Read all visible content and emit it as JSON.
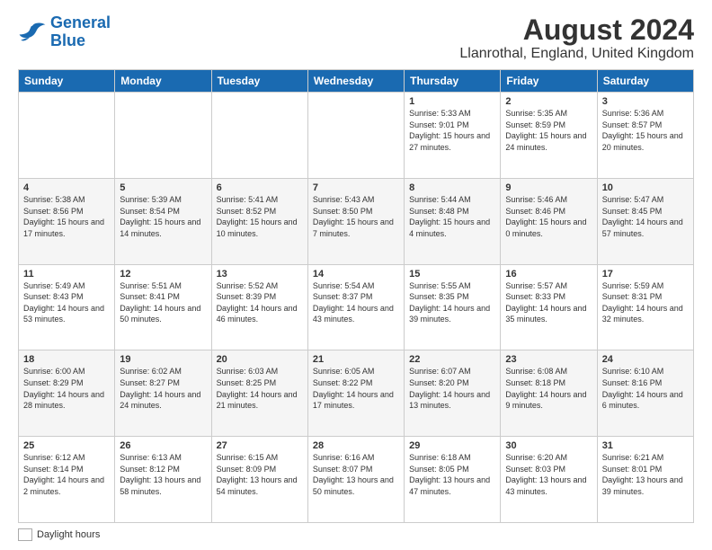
{
  "header": {
    "logo_general": "General",
    "logo_blue": "Blue",
    "month_year": "August 2024",
    "location": "Llanrothal, England, United Kingdom"
  },
  "weekdays": [
    "Sunday",
    "Monday",
    "Tuesday",
    "Wednesday",
    "Thursday",
    "Friday",
    "Saturday"
  ],
  "weeks": [
    [
      {
        "day": "",
        "info": ""
      },
      {
        "day": "",
        "info": ""
      },
      {
        "day": "",
        "info": ""
      },
      {
        "day": "",
        "info": ""
      },
      {
        "day": "1",
        "info": "Sunrise: 5:33 AM\nSunset: 9:01 PM\nDaylight: 15 hours and 27 minutes."
      },
      {
        "day": "2",
        "info": "Sunrise: 5:35 AM\nSunset: 8:59 PM\nDaylight: 15 hours and 24 minutes."
      },
      {
        "day": "3",
        "info": "Sunrise: 5:36 AM\nSunset: 8:57 PM\nDaylight: 15 hours and 20 minutes."
      }
    ],
    [
      {
        "day": "4",
        "info": "Sunrise: 5:38 AM\nSunset: 8:56 PM\nDaylight: 15 hours and 17 minutes."
      },
      {
        "day": "5",
        "info": "Sunrise: 5:39 AM\nSunset: 8:54 PM\nDaylight: 15 hours and 14 minutes."
      },
      {
        "day": "6",
        "info": "Sunrise: 5:41 AM\nSunset: 8:52 PM\nDaylight: 15 hours and 10 minutes."
      },
      {
        "day": "7",
        "info": "Sunrise: 5:43 AM\nSunset: 8:50 PM\nDaylight: 15 hours and 7 minutes."
      },
      {
        "day": "8",
        "info": "Sunrise: 5:44 AM\nSunset: 8:48 PM\nDaylight: 15 hours and 4 minutes."
      },
      {
        "day": "9",
        "info": "Sunrise: 5:46 AM\nSunset: 8:46 PM\nDaylight: 15 hours and 0 minutes."
      },
      {
        "day": "10",
        "info": "Sunrise: 5:47 AM\nSunset: 8:45 PM\nDaylight: 14 hours and 57 minutes."
      }
    ],
    [
      {
        "day": "11",
        "info": "Sunrise: 5:49 AM\nSunset: 8:43 PM\nDaylight: 14 hours and 53 minutes."
      },
      {
        "day": "12",
        "info": "Sunrise: 5:51 AM\nSunset: 8:41 PM\nDaylight: 14 hours and 50 minutes."
      },
      {
        "day": "13",
        "info": "Sunrise: 5:52 AM\nSunset: 8:39 PM\nDaylight: 14 hours and 46 minutes."
      },
      {
        "day": "14",
        "info": "Sunrise: 5:54 AM\nSunset: 8:37 PM\nDaylight: 14 hours and 43 minutes."
      },
      {
        "day": "15",
        "info": "Sunrise: 5:55 AM\nSunset: 8:35 PM\nDaylight: 14 hours and 39 minutes."
      },
      {
        "day": "16",
        "info": "Sunrise: 5:57 AM\nSunset: 8:33 PM\nDaylight: 14 hours and 35 minutes."
      },
      {
        "day": "17",
        "info": "Sunrise: 5:59 AM\nSunset: 8:31 PM\nDaylight: 14 hours and 32 minutes."
      }
    ],
    [
      {
        "day": "18",
        "info": "Sunrise: 6:00 AM\nSunset: 8:29 PM\nDaylight: 14 hours and 28 minutes."
      },
      {
        "day": "19",
        "info": "Sunrise: 6:02 AM\nSunset: 8:27 PM\nDaylight: 14 hours and 24 minutes."
      },
      {
        "day": "20",
        "info": "Sunrise: 6:03 AM\nSunset: 8:25 PM\nDaylight: 14 hours and 21 minutes."
      },
      {
        "day": "21",
        "info": "Sunrise: 6:05 AM\nSunset: 8:22 PM\nDaylight: 14 hours and 17 minutes."
      },
      {
        "day": "22",
        "info": "Sunrise: 6:07 AM\nSunset: 8:20 PM\nDaylight: 14 hours and 13 minutes."
      },
      {
        "day": "23",
        "info": "Sunrise: 6:08 AM\nSunset: 8:18 PM\nDaylight: 14 hours and 9 minutes."
      },
      {
        "day": "24",
        "info": "Sunrise: 6:10 AM\nSunset: 8:16 PM\nDaylight: 14 hours and 6 minutes."
      }
    ],
    [
      {
        "day": "25",
        "info": "Sunrise: 6:12 AM\nSunset: 8:14 PM\nDaylight: 14 hours and 2 minutes."
      },
      {
        "day": "26",
        "info": "Sunrise: 6:13 AM\nSunset: 8:12 PM\nDaylight: 13 hours and 58 minutes."
      },
      {
        "day": "27",
        "info": "Sunrise: 6:15 AM\nSunset: 8:09 PM\nDaylight: 13 hours and 54 minutes."
      },
      {
        "day": "28",
        "info": "Sunrise: 6:16 AM\nSunset: 8:07 PM\nDaylight: 13 hours and 50 minutes."
      },
      {
        "day": "29",
        "info": "Sunrise: 6:18 AM\nSunset: 8:05 PM\nDaylight: 13 hours and 47 minutes."
      },
      {
        "day": "30",
        "info": "Sunrise: 6:20 AM\nSunset: 8:03 PM\nDaylight: 13 hours and 43 minutes."
      },
      {
        "day": "31",
        "info": "Sunrise: 6:21 AM\nSunset: 8:01 PM\nDaylight: 13 hours and 39 minutes."
      }
    ]
  ],
  "footer": {
    "daylight_label": "Daylight hours"
  }
}
